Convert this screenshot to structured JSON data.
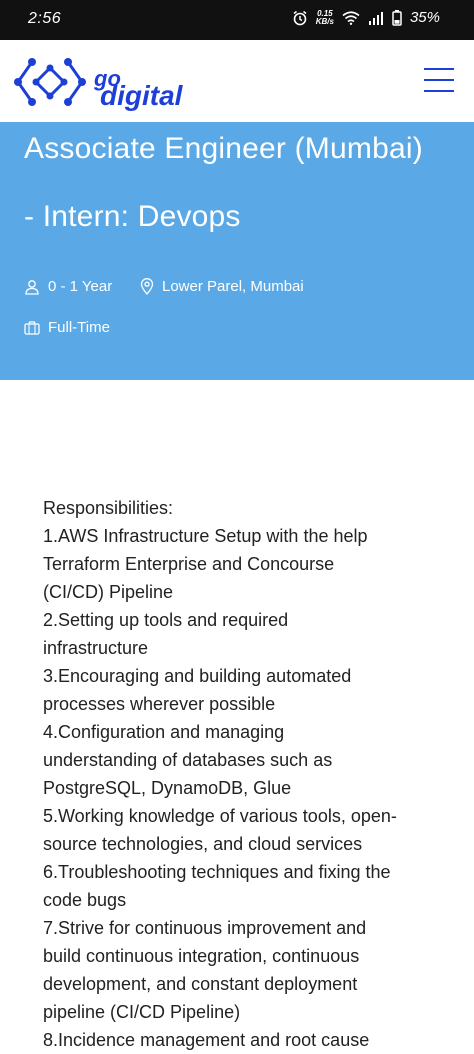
{
  "status_bar": {
    "time": "2:56",
    "speed_value": "0.15",
    "speed_unit": "KB/s",
    "battery": "35%"
  },
  "header": {
    "logo_go": "go",
    "logo_digital": "digital",
    "brand_color": "#1d3fd6"
  },
  "hero": {
    "title_line1": "Associate Engineer (Mumbai)",
    "title_line2": "- Intern: Devops",
    "experience": "0 - 1 Year",
    "location": "Lower Parel, Mumbai",
    "job_type": "Full-Time",
    "background_color": "#5aa9e6"
  },
  "content": {
    "lines": [
      "Responsibilities:",
      "1.AWS Infrastructure Setup with the help",
      "Terraform Enterprise and Concourse",
      "(CI/CD) Pipeline",
      "2.Setting up tools and required",
      "infrastructure",
      "3.Encouraging and building automated",
      "processes wherever possible",
      "4.Configuration and managing",
      "understanding of databases such as",
      "PostgreSQL, DynamoDB, Glue",
      "5.Working knowledge of various tools, open-",
      "source technologies, and cloud services",
      "6.Troubleshooting techniques and fixing the",
      "code bugs",
      "7.Strive for continuous improvement and",
      "build continuous integration, continuous",
      "development, and constant deployment",
      "pipeline (CI/CD Pipeline)",
      "8.Incidence management and root cause"
    ]
  }
}
